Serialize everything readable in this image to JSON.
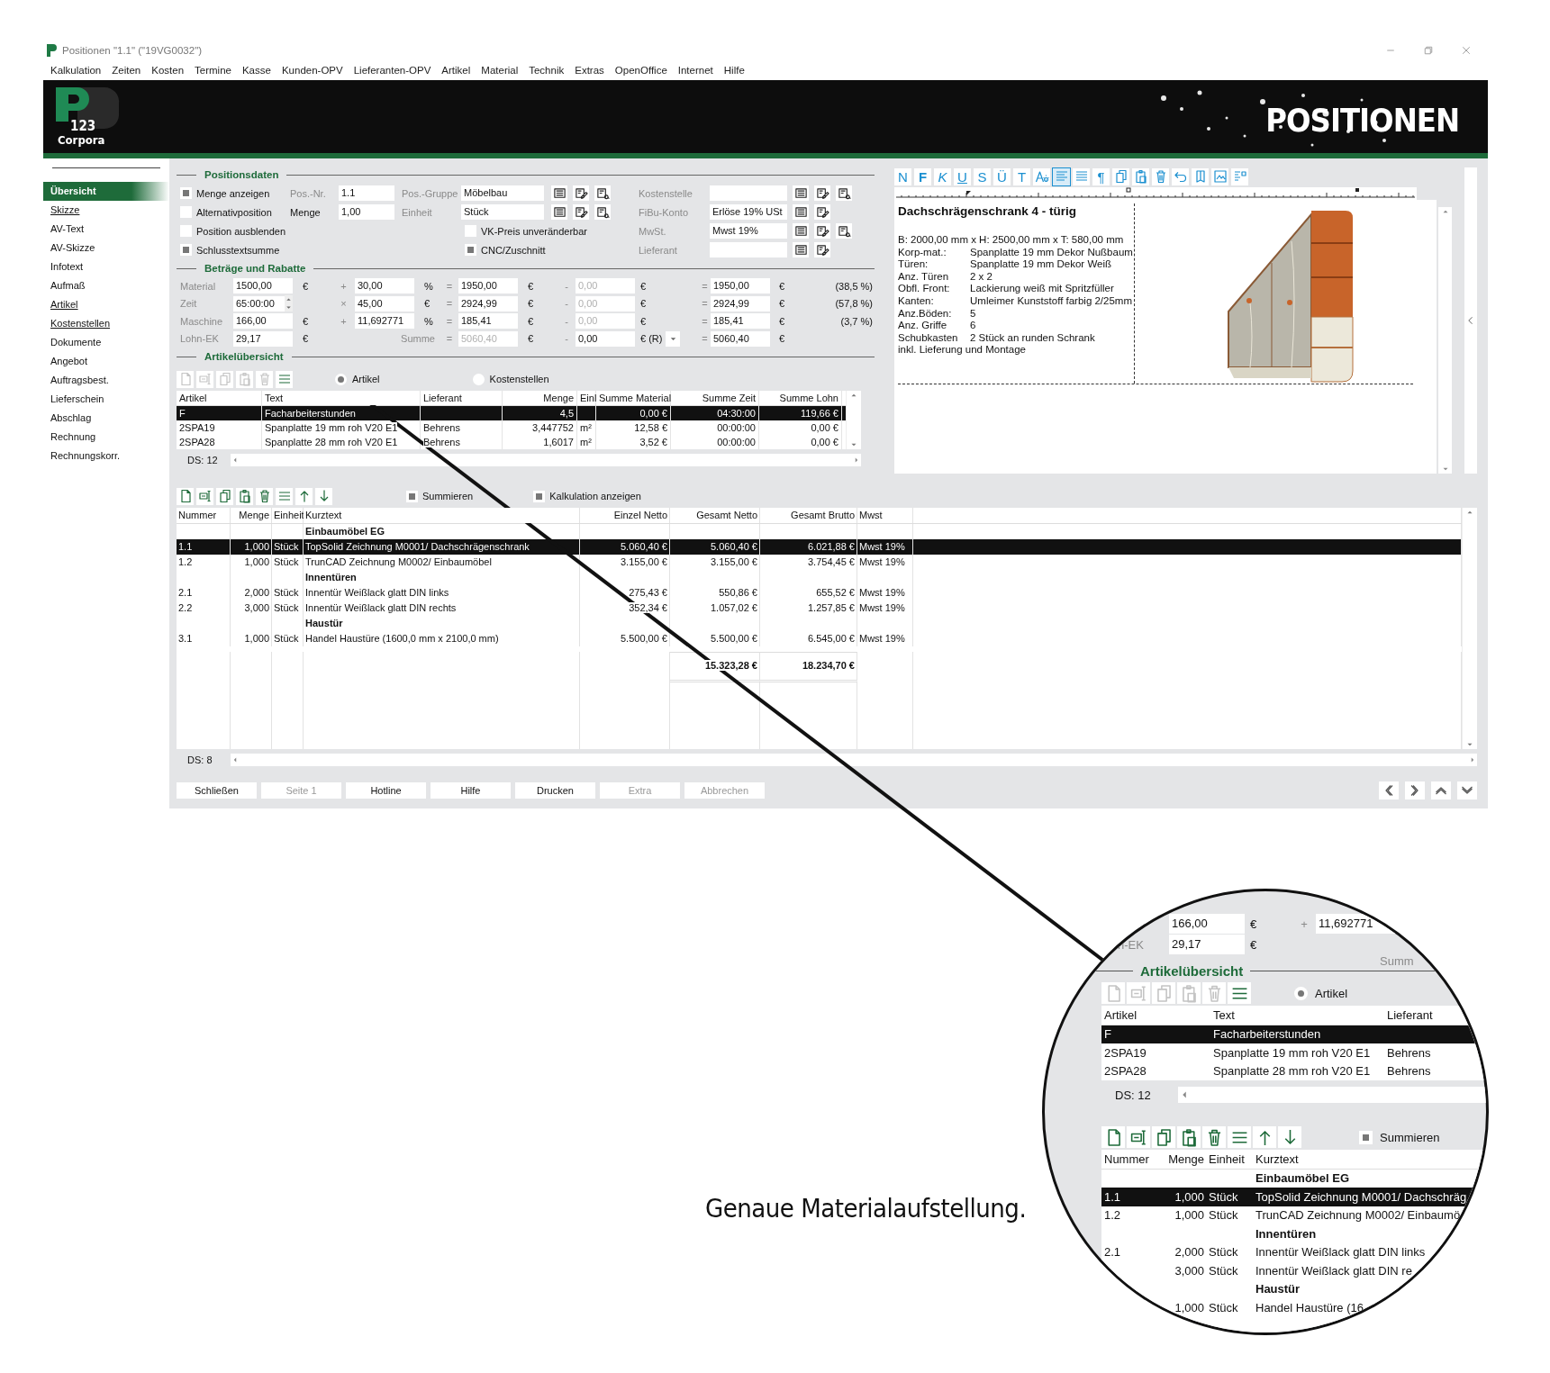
{
  "window": {
    "title": "Positionen \"1.1\" (\"19VG0032\")"
  },
  "menu": [
    "Kalkulation",
    "Zeiten",
    "Kosten",
    "Termine",
    "Kasse",
    "Kunden-OPV",
    "Lieferanten-OPV",
    "Artikel",
    "Material",
    "Technik",
    "Extras",
    "OpenOffice",
    "Internet",
    "Hilfe"
  ],
  "header": {
    "logo_number": "123",
    "logo_name": "Corpora",
    "title": "POSITIONEN"
  },
  "sidebar": {
    "items": [
      {
        "label": "Übersicht",
        "selected": true,
        "linked": false
      },
      {
        "label": "Skizze",
        "selected": false,
        "linked": true
      },
      {
        "label": "AV-Text",
        "selected": false,
        "linked": false
      },
      {
        "label": "AV-Skizze",
        "selected": false,
        "linked": false
      },
      {
        "label": "Infotext",
        "selected": false,
        "linked": false
      },
      {
        "label": "Aufmaß",
        "selected": false,
        "linked": false
      },
      {
        "label": "Artikel",
        "selected": false,
        "linked": true
      },
      {
        "label": "Kostenstellen",
        "selected": false,
        "linked": true
      },
      {
        "label": "Dokumente",
        "selected": false,
        "linked": false
      },
      {
        "label": "Angebot",
        "selected": false,
        "linked": false
      },
      {
        "label": "Auftragsbest.",
        "selected": false,
        "linked": false
      },
      {
        "label": "Lieferschein",
        "selected": false,
        "linked": false
      },
      {
        "label": "Abschlag",
        "selected": false,
        "linked": false
      },
      {
        "label": "Rechnung",
        "selected": false,
        "linked": false
      },
      {
        "label": "Rechnungskorr.",
        "selected": false,
        "linked": false
      }
    ]
  },
  "positionsdaten": {
    "title": "Positionsdaten",
    "rows": [
      {
        "checkbox": {
          "label": "Menge anzeigen",
          "checked": true
        },
        "field1": {
          "label": "Pos.-Nr.",
          "value": "1.1",
          "disabled": true
        },
        "field2": {
          "label": "Pos.-Gruppe",
          "value": "Möbelbau",
          "disabled": true,
          "buttons": [
            {
              "kind": "list"
            },
            {
              "kind": "edit"
            },
            {
              "kind": "find"
            }
          ]
        },
        "field3": {
          "label": "Kostenstelle",
          "disabled": true,
          "buttons": [
            {
              "kind": "list"
            },
            {
              "kind": "edit"
            },
            {
              "kind": "find"
            }
          ]
        }
      },
      {
        "checkbox": {
          "label": "Alternativposition",
          "checked": false
        },
        "field1": {
          "label": "Menge",
          "value": "1,00",
          "disabled": false
        },
        "field2": {
          "label": "Einheit",
          "value": "Stück",
          "disabled": true,
          "buttons": [
            {
              "kind": "list"
            },
            {
              "kind": "edit"
            },
            {
              "kind": "find"
            }
          ]
        },
        "field3": {
          "label": "FiBu-Konto",
          "value": "Erlöse 19% USt",
          "disabled": true,
          "buttons": [
            {
              "kind": "list"
            },
            {
              "kind": "edit"
            }
          ]
        }
      },
      {
        "checkbox": {
          "label": "Position ausblenden",
          "checked": false
        },
        "checkbox2": {
          "label": "VK-Preis unveränderbar",
          "checked": false
        },
        "field3": {
          "label": "MwSt.",
          "value": "Mwst 19%",
          "disabled": true,
          "buttons": [
            {
              "kind": "list"
            },
            {
              "kind": "edit"
            },
            {
              "kind": "find"
            }
          ]
        }
      },
      {
        "checkbox": {
          "label": "Schlusstextsumme",
          "checked": true
        },
        "checkbox2": {
          "label": "CNC/Zuschnitt",
          "checked": true
        },
        "field3": {
          "label": "Lieferant",
          "disabled": true,
          "buttons": [
            {
              "kind": "list"
            },
            {
              "kind": "edit"
            }
          ]
        }
      }
    ]
  },
  "betraege": {
    "title": "Beträge und Rabatte",
    "rows": [
      {
        "label": "Material",
        "base": {
          "value": "1500,00",
          "spinner": false
        },
        "base_unit": "€",
        "op": "+",
        "factor": {
          "value": "30,00"
        },
        "factor_unit": "%",
        "eq": "=",
        "result": {
          "value": "1950,00",
          "disabled": false
        },
        "result_unit": "€",
        "minus": "-",
        "discount": {
          "value": "0,00",
          "disabled": true
        },
        "discount_unit": "€",
        "eq2": "=",
        "total": {
          "value": "1950,00"
        },
        "total_unit": "€",
        "share": "(38,5 %)"
      },
      {
        "label": "Zeit",
        "base": {
          "value": "65:00:00",
          "spinner": true
        },
        "op": "×",
        "factor": {
          "value": "45,00"
        },
        "factor_unit": "€",
        "eq": "=",
        "result": {
          "value": "2924,99",
          "disabled": false
        },
        "result_unit": "€",
        "minus": "-",
        "discount": {
          "value": "0,00",
          "disabled": true
        },
        "discount_unit": "€",
        "eq2": "=",
        "total": {
          "value": "2924,99"
        },
        "total_unit": "€",
        "share": "(57,8 %)"
      },
      {
        "label": "Maschine",
        "base": {
          "value": "166,00",
          "spinner": false
        },
        "base_unit": "€",
        "op": "+",
        "factor": {
          "value": "11,692771"
        },
        "factor_unit": "%",
        "eq": "=",
        "result": {
          "value": "185,41",
          "disabled": false
        },
        "result_unit": "€",
        "minus": "-",
        "discount": {
          "value": "0,00",
          "disabled": true
        },
        "discount_unit": "€",
        "eq2": "=",
        "total": {
          "value": "185,41"
        },
        "total_unit": "€",
        "share": "(3,7 %)"
      },
      {
        "label": "Lohn-EK",
        "base": {
          "value": "29,17",
          "spinner": false
        },
        "base_unit": "€",
        "sum_label": "Summe",
        "eq": "=",
        "result": {
          "value": "5060,40",
          "disabled": true
        },
        "result_unit": "€",
        "minus": "-",
        "discount": {
          "value": "0,00",
          "disabled": false
        },
        "discount_unit": "€ (R)",
        "dropdown": true,
        "eq2": "=",
        "total": {
          "value": "5060,40"
        },
        "total_unit": "€"
      }
    ]
  },
  "artikel": {
    "title": "Artikelübersicht",
    "toolbar": [
      {
        "kind": "new",
        "disabled": true
      },
      {
        "kind": "rename",
        "disabled": true
      },
      {
        "kind": "copy",
        "disabled": true
      },
      {
        "kind": "paste",
        "disabled": true
      },
      {
        "kind": "delete",
        "disabled": true
      },
      {
        "kind": "lines",
        "disabled": false
      }
    ],
    "radios": [
      {
        "label": "Artikel",
        "selected": true
      },
      {
        "label": "Kostenstellen",
        "selected": false
      }
    ],
    "columns": [
      "Artikel",
      "Text",
      "Lieferant",
      "Menge",
      "Einl",
      "Summe Material",
      "Summe Zeit",
      "Summe Lohn"
    ],
    "rows": [
      {
        "artikel": "F",
        "text": "Facharbeiterstunden",
        "menge": "4,5",
        "material": "0,00 €",
        "zeit": "04:30:00",
        "lohn": "119,66 €",
        "selected": true
      },
      {
        "artikel": "2SPA19",
        "text": "Spanplatte 19 mm roh V20 E1",
        "lieferant": "Behrens",
        "menge": "3,447752",
        "einheit": "m²",
        "material": "12,58 €",
        "zeit": "00:00:00",
        "lohn": "0,00 €",
        "selected": false
      },
      {
        "artikel": "2SPA28",
        "text": "Spanplatte 28 mm roh V20 E1",
        "lieferant": "Behrens",
        "menge": "1,6017",
        "einheit": "m²",
        "material": "3,52 €",
        "zeit": "00:00:00",
        "lohn": "0,00 €",
        "selected": false
      }
    ],
    "record_count": "DS: 12"
  },
  "positionen": {
    "toolbar": [
      {
        "kind": "new",
        "disabled": false
      },
      {
        "kind": "rename",
        "disabled": false
      },
      {
        "kind": "copy",
        "disabled": false
      },
      {
        "kind": "paste",
        "disabled": false
      },
      {
        "kind": "delete",
        "disabled": false
      },
      {
        "kind": "lines",
        "disabled": false
      },
      {
        "kind": "up",
        "disabled": false
      },
      {
        "kind": "down",
        "disabled": false
      }
    ],
    "checkboxes": [
      {
        "label": "Summieren",
        "checked": true
      },
      {
        "label": "Kalkulation anzeigen",
        "checked": true
      }
    ],
    "columns": [
      "Nummer",
      "Menge",
      "Einheit",
      "Kurztext",
      "Einzel Netto",
      "Gesamt Netto",
      "Gesamt Brutto",
      "Mwst"
    ],
    "rows": [
      {
        "kind": "group",
        "text": "Einbaumöbel EG",
        "selected": false
      },
      {
        "kind": "item",
        "number": "1.1",
        "qty": "1,000",
        "unit": "Stück",
        "text": "TopSolid Zeichnung M0001/ Dachschrägenschrank",
        "unit_price": "5.060,40 €",
        "net": "5.060,40 €",
        "gross": "6.021,88 €",
        "vat": "Mwst 19%",
        "selected": true
      },
      {
        "kind": "item",
        "number": "1.2",
        "qty": "1,000",
        "unit": "Stück",
        "text": "TrunCAD Zeichnung M0002/ Einbaumöbel",
        "unit_price": "3.155,00 €",
        "net": "3.155,00 €",
        "gross": "3.754,45 €",
        "vat": "Mwst 19%",
        "selected": false
      },
      {
        "kind": "group",
        "text": "Innentüren",
        "selected": false
      },
      {
        "kind": "item",
        "number": "2.1",
        "qty": "2,000",
        "unit": "Stück",
        "text": "Innentür Weißlack glatt DIN links",
        "unit_price": "275,43 €",
        "net": "550,86 €",
        "gross": "655,52 €",
        "vat": "Mwst 19%",
        "selected": false
      },
      {
        "kind": "item",
        "number": "2.2",
        "qty": "3,000",
        "unit": "Stück",
        "text": "Innentür Weißlack glatt DIN rechts",
        "unit_price": "352,34 €",
        "net": "1.057,02 €",
        "gross": "1.257,85 €",
        "vat": "Mwst 19%",
        "selected": false
      },
      {
        "kind": "group",
        "text": "Haustür",
        "selected": false
      },
      {
        "kind": "item",
        "number": "3.1",
        "qty": "1,000",
        "unit": "Stück",
        "text": "Handel Haustüre (1600,0 mm x 2100,0 mm)",
        "unit_price": "5.500,00 €",
        "net": "5.500,00 €",
        "gross": "6.545,00 €",
        "vat": "Mwst 19%",
        "selected": false
      },
      {
        "kind": "total",
        "net": "15.323,28 €",
        "gross": "18.234,70 €",
        "selected": false
      }
    ],
    "record_count": "DS: 8"
  },
  "buttons": [
    {
      "label": "Schließen",
      "disabled": false
    },
    {
      "label": "Seite 1",
      "disabled": true
    },
    {
      "label": "Hotline",
      "disabled": false
    },
    {
      "label": "Hilfe",
      "disabled": false
    },
    {
      "label": "Drucken",
      "disabled": false
    },
    {
      "label": "Extra",
      "disabled": true
    },
    {
      "label": "Abbrechen",
      "disabled": true
    }
  ],
  "nav_buttons": [
    {
      "kind": "prev"
    },
    {
      "kind": "next"
    },
    {
      "kind": "up"
    },
    {
      "kind": "down"
    }
  ],
  "editor": {
    "toolbar": [
      {
        "kind": "plain",
        "label": "N",
        "selected": false
      },
      {
        "kind": "bold",
        "label": "F",
        "selected": false
      },
      {
        "kind": "italic",
        "label": "K",
        "selected": false
      },
      {
        "kind": "underline",
        "label": "U",
        "selected": false
      },
      {
        "kind": "plain",
        "label": "S",
        "selected": false
      },
      {
        "kind": "plain",
        "label": "Ü",
        "selected": false
      },
      {
        "kind": "plain",
        "label": "T",
        "selected": false
      },
      {
        "kind": "fontsettings",
        "selected": false
      },
      {
        "kind": "alignleft",
        "selected": true
      },
      {
        "kind": "justify",
        "selected": false
      },
      {
        "kind": "plain",
        "label": "¶",
        "selected": false
      },
      {
        "kind": "copy",
        "selected": false
      },
      {
        "kind": "paste",
        "selected": false
      },
      {
        "kind": "delete",
        "selected": false
      },
      {
        "kind": "undo",
        "selected": false
      },
      {
        "kind": "page",
        "selected": false
      },
      {
        "kind": "image",
        "selected": false
      },
      {
        "kind": "layout",
        "selected": false
      }
    ],
    "heading": "Dachschrägenschrank  4 - türig",
    "lines": [
      {
        "kind": "text",
        "text": "B: 2000,00 mm x H: 2500,00 mm x T: 580,00 mm"
      },
      {
        "kind": "pair",
        "key": "Korp-mat.:",
        "value": "Spanplatte 19 mm Dekor Nußbaum"
      },
      {
        "kind": "pair",
        "key": "Türen:",
        "value": "Spanplatte 19 mm Dekor Weiß"
      },
      {
        "kind": "pair",
        "key": "Anz. Türen",
        "value": "2 x 2"
      },
      {
        "kind": "pair",
        "key": "Obfl. Front:",
        "value": "Lackierung weiß mit Spritzfüller"
      },
      {
        "kind": "pair",
        "key": "Kanten:",
        "value": "Umleimer Kunststoff farbig 2/25mm"
      },
      {
        "kind": "pair",
        "key": "Anz.Böden:",
        "value": "5"
      },
      {
        "kind": "pair",
        "key": "Anz. Griffe",
        "value": "6"
      },
      {
        "kind": "pair",
        "key": "Schubkasten",
        "value": "2 Stück an runden Schrank"
      },
      {
        "kind": "text",
        "text": "inkl. Lieferung und Montage"
      }
    ]
  },
  "caption": "Genaue Materialaufstellung.",
  "magnifier": {
    "amount_rows": [
      {
        "value": "166,00",
        "unit": "€",
        "op": "+",
        "factor": "11,692771"
      },
      {
        "label": "n-EK",
        "value": "29,17",
        "unit": "€",
        "sum_label": "Summ"
      }
    ],
    "section_title": "Artikelübersicht",
    "toolbar": [
      {
        "kind": "new",
        "disabled": true
      },
      {
        "kind": "rename",
        "disabled": true
      },
      {
        "kind": "copy",
        "disabled": true
      },
      {
        "kind": "paste",
        "disabled": true
      },
      {
        "kind": "delete",
        "disabled": true
      },
      {
        "kind": "lines",
        "disabled": false
      }
    ],
    "radio": {
      "label": "Artikel",
      "selected": true
    },
    "columns": [
      "Artikel",
      "Text",
      "Lieferant"
    ],
    "rows": [
      {
        "artikel": "F",
        "text": "Facharbeiterstunden",
        "selected": true
      },
      {
        "artikel": "2SPA19",
        "text": "Spanplatte 19 mm roh V20 E1",
        "lieferant": "Behrens",
        "selected": false
      },
      {
        "artikel": "2SPA28",
        "text": "Spanplatte 28 mm roh V20 E1",
        "lieferant": "Behrens",
        "selected": false
      }
    ],
    "record_count": "DS: 12",
    "toolbar2": [
      {
        "kind": "new",
        "disabled": false
      },
      {
        "kind": "rename",
        "disabled": false
      },
      {
        "kind": "copy",
        "disabled": false
      },
      {
        "kind": "paste",
        "disabled": false
      },
      {
        "kind": "delete",
        "disabled": false
      },
      {
        "kind": "lines",
        "disabled": false
      },
      {
        "kind": "up",
        "disabled": false
      },
      {
        "kind": "down",
        "disabled": false
      }
    ],
    "checkbox": {
      "label": "Summieren",
      "checked": true
    },
    "pos_columns": [
      "Nummer",
      "Menge",
      "Einheit",
      "Kurztext"
    ],
    "pos_rows": [
      {
        "kind": "group",
        "text": "Einbaumöbel EG",
        "selected": false
      },
      {
        "kind": "item",
        "number": "1.1",
        "qty": "1,000",
        "unit": "Stück",
        "text": "TopSolid Zeichnung M0001/ Dachschräg",
        "selected": true
      },
      {
        "kind": "item",
        "number": "1.2",
        "qty": "1,000",
        "unit": "Stück",
        "text": "TrunCAD Zeichnung M0002/ Einbaumö",
        "selected": false
      },
      {
        "kind": "group",
        "text": "Innentüren",
        "selected": false
      },
      {
        "kind": "item",
        "number": "2.1",
        "qty": "2,000",
        "unit": "Stück",
        "text": "Innentür Weißlack glatt DIN links",
        "selected": false
      },
      {
        "kind": "item",
        "qty": "3,000",
        "unit": "Stück",
        "text": "Innentür Weißlack glatt DIN re",
        "selected": false
      },
      {
        "kind": "group",
        "text": "Haustür",
        "selected": false
      },
      {
        "kind": "item",
        "qty": "1,000",
        "unit": "Stück",
        "text": "Handel Haustüre (16",
        "selected": false
      }
    ]
  }
}
